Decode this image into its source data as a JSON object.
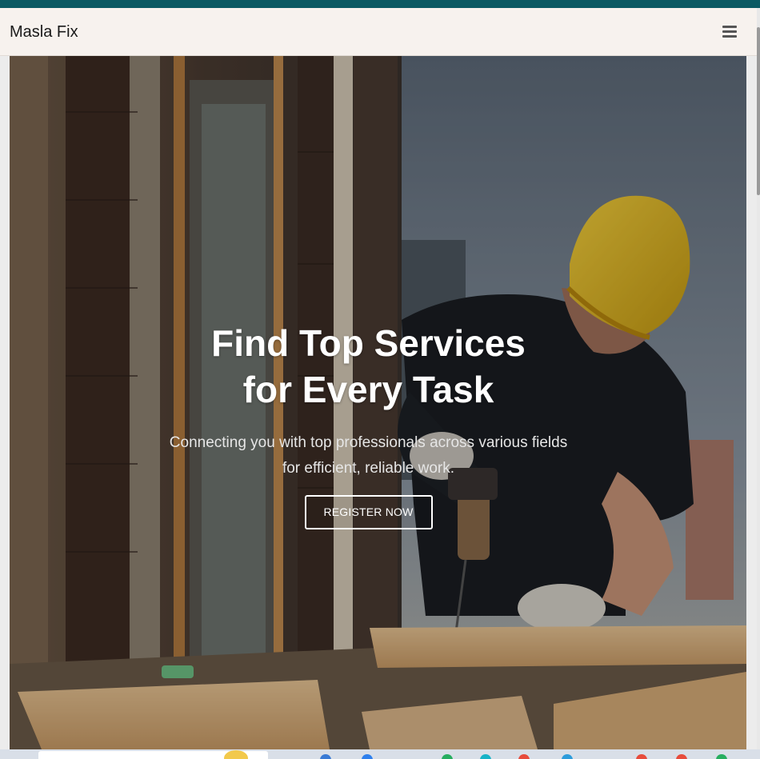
{
  "navbar": {
    "brand": "Masla Fix",
    "menu_icon": "hamburger-menu-icon"
  },
  "hero": {
    "title_line1": "Find Top Services",
    "title_line2": "for Every Task",
    "subtitle": "Connecting you with top professionals across various fields for efficient, reliable work.",
    "cta_label": "REGISTER NOW",
    "background_image": "construction-worker-drilling-wood-photo"
  },
  "colors": {
    "top_strip": "#0b5a63",
    "navbar_bg": "#f7f2ee",
    "button_border": "#ffffff"
  },
  "taskbar": {
    "icons": [
      "weather-icon",
      "browser-icon",
      "file-explorer-icon",
      "edge-icon",
      "store-icon",
      "chrome-icon",
      "app-icon",
      "app-icon",
      "app-icon",
      "app-icon"
    ]
  }
}
